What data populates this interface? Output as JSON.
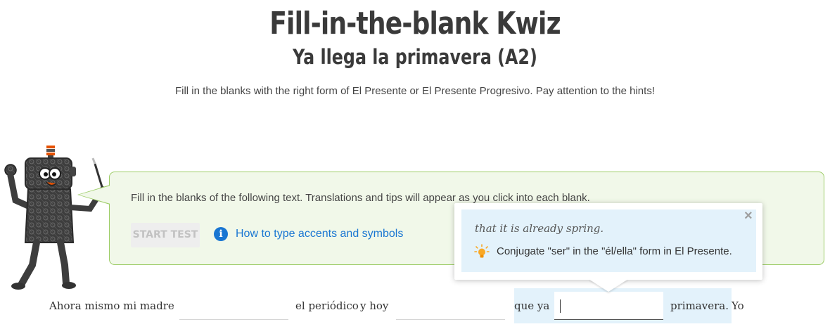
{
  "header": {
    "title": "Fill-in-the-blank Kwiz",
    "subtitle": "Ya llega la primavera (A2)",
    "description": "Fill in the blanks with the right form of El Presente or El Presente Progresivo. Pay attention to the hints!"
  },
  "panel": {
    "instructions": "Fill in the blanks of the following text. Translations and tips will appear as you click into each blank.",
    "start_button": "START TEST",
    "accents_link": "How to type accents and symbols",
    "info_icon_glyph": "i"
  },
  "popup": {
    "close_glyph": "×",
    "translation": "that it is already spring.",
    "hint": "Conjugate \"ser\" in the \"él/ella\" form in El Presente."
  },
  "exercise": {
    "segments": [
      "Ahora mismo mi madre",
      "el periódico",
      "y hoy",
      "que ya",
      "primavera.",
      "Yo"
    ],
    "blanks": [
      {
        "value": "",
        "placeholder": ""
      },
      {
        "value": "",
        "placeholder": ""
      },
      {
        "value": "",
        "placeholder": ""
      }
    ]
  },
  "colors": {
    "panel_bg": "#f1f8e9",
    "panel_border": "#9ccc65",
    "link_blue": "#1976d2",
    "popup_bg": "#e3f2fb"
  }
}
